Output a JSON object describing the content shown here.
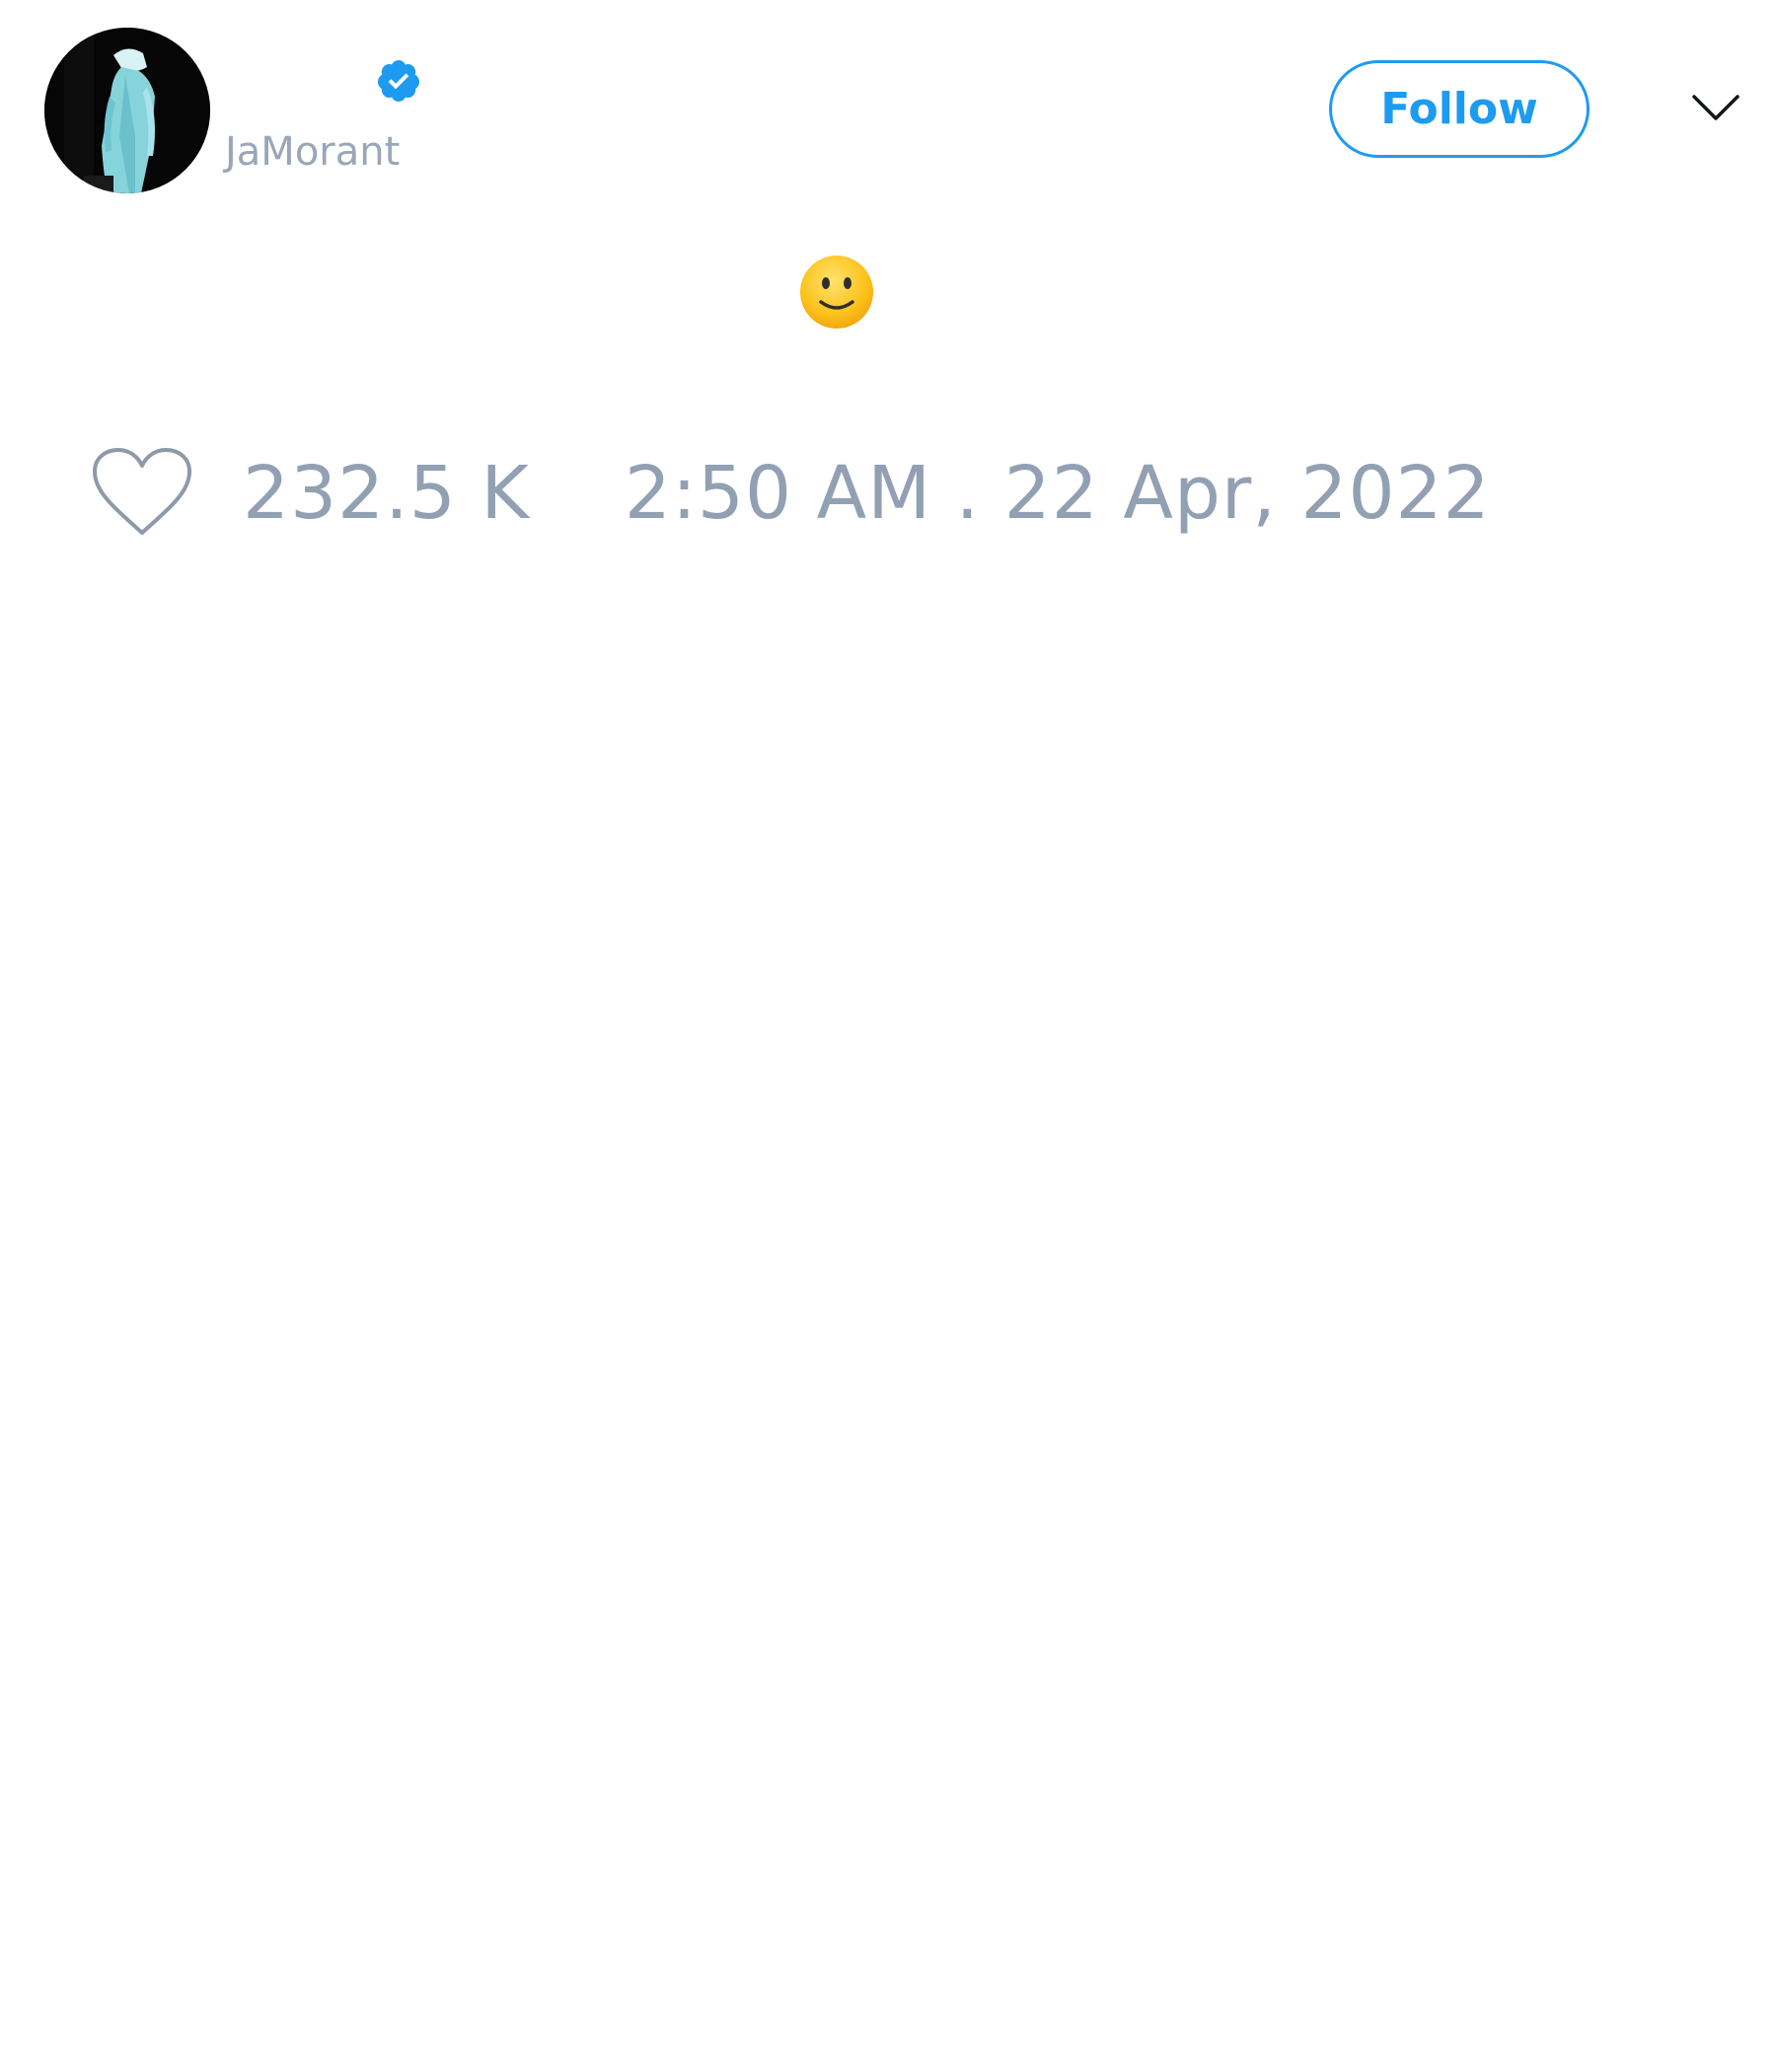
{
  "author": {
    "display_name": "",
    "username": "JaMorant",
    "verified": true,
    "avatar_icon": "profile-photo-person-in-light-blue-tracksuit"
  },
  "actions": {
    "follow_label": "Follow",
    "more_icon": "chevron-down-icon"
  },
  "tweet": {
    "text": "",
    "emoji_icon": "slightly-smiling-face-emoji"
  },
  "footer": {
    "like_icon": "heart-outline-icon",
    "like_count": "232.5 K",
    "timestamp": "2:50 AM . 22 Apr, 2022"
  },
  "colors": {
    "accent": "#1d9bf0",
    "muted_text": "#92a0b3",
    "background": "#ffffff"
  }
}
